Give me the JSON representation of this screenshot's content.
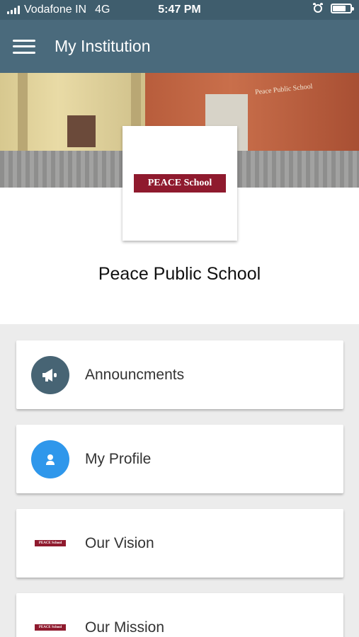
{
  "status_bar": {
    "carrier": "Vodafone IN",
    "network": "4G",
    "time": "5:47 PM"
  },
  "app_bar": {
    "title": "My Institution"
  },
  "banner": {
    "building_sign": "Peace Public School"
  },
  "logo": {
    "text": "PEACE School",
    "color": "#8f1a2e"
  },
  "school": {
    "name": "Peace Public School"
  },
  "menu": {
    "items": [
      {
        "label": "Announcments",
        "icon": "megaphone-icon",
        "icon_color": "#476474"
      },
      {
        "label": "My Profile",
        "icon": "person-icon",
        "icon_color": "#2f97eb"
      },
      {
        "label": "Our Vision",
        "icon": "school-logo-icon",
        "icon_text": "PEACE School"
      },
      {
        "label": "Our Mission",
        "icon": "school-logo-icon",
        "icon_text": "PEACE School"
      }
    ]
  },
  "colors": {
    "app_bar": "#4a6a7c",
    "status_bar": "#3f5d6d",
    "background": "#ececec"
  }
}
